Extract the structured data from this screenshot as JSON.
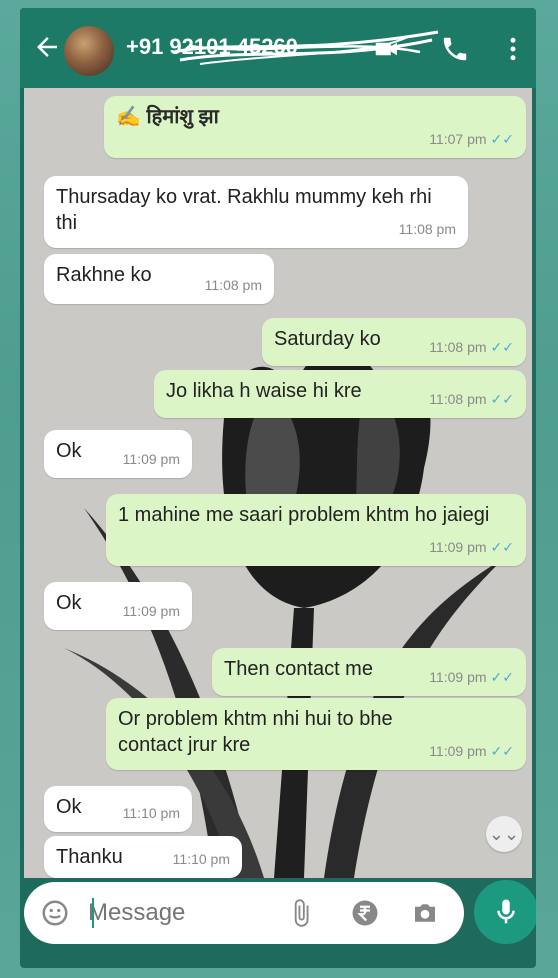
{
  "header": {
    "contact": "+91 92101 45260",
    "icons": [
      "back-arrow-icon",
      "video-call-icon",
      "phone-icon",
      "more-vert-icon"
    ]
  },
  "messages": [
    {
      "dir": "out",
      "text": "✍️ हिमांशु झा",
      "time": "11:07 pm",
      "ticks": "✓✓"
    },
    {
      "dir": "in",
      "text": "Thursaday ko vrat. Rakhlu mummy keh rhi thi",
      "time": "11:08 pm"
    },
    {
      "dir": "in",
      "text": "Rakhne ko",
      "time": "11:08 pm"
    },
    {
      "dir": "out",
      "text": "Saturday ko",
      "time": "11:08 pm",
      "ticks": "✓✓"
    },
    {
      "dir": "out",
      "text": "Jo likha h waise hi kre",
      "time": "11:08 pm",
      "ticks": "✓✓"
    },
    {
      "dir": "in",
      "text": "Ok",
      "time": "11:09 pm"
    },
    {
      "dir": "out",
      "text": "1 mahine me saari problem khtm ho jaiegi",
      "time": "11:09 pm",
      "ticks": "✓✓"
    },
    {
      "dir": "in",
      "text": "Ok",
      "time": "11:09 pm"
    },
    {
      "dir": "out",
      "text": "Then contact me",
      "time": "11:09 pm",
      "ticks": "✓✓"
    },
    {
      "dir": "out",
      "text": "Or problem khtm nhi hui to bhe contact jrur kre",
      "time": "11:09 pm",
      "ticks": "✓✓"
    },
    {
      "dir": "in",
      "text": "Ok",
      "time": "11:10 pm"
    },
    {
      "dir": "in",
      "text": "Thanku",
      "time": "11:10 pm"
    }
  ],
  "scroll_down_glyph": "⌄⌄",
  "input": {
    "placeholder": "Message",
    "icons": [
      "emoji-icon",
      "attach-icon",
      "rupee-icon",
      "camera-icon",
      "mic-icon"
    ]
  },
  "colors": {
    "header": "#1c7a67",
    "outgoing": "#dcf5c6",
    "incoming": "#ffffff",
    "ticks": "#4fa8d8",
    "mic": "#1c9a80"
  }
}
